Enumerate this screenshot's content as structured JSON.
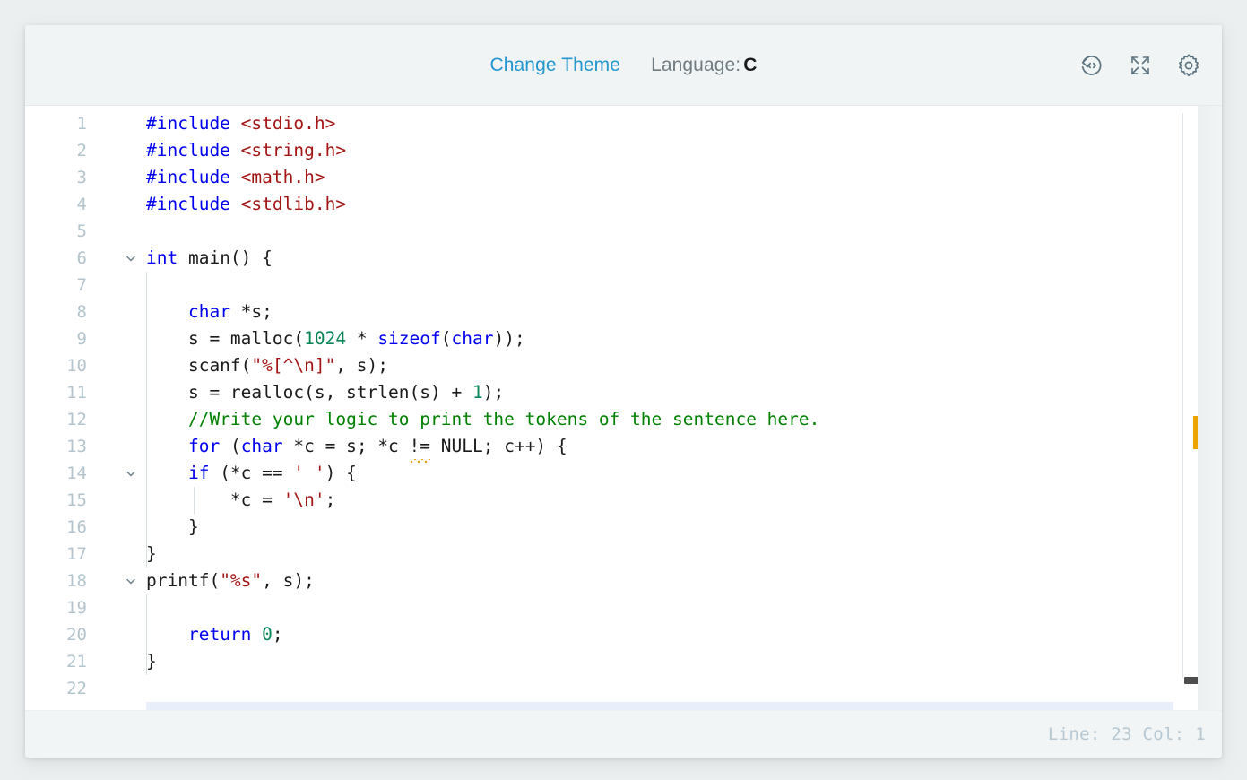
{
  "header": {
    "change_theme_label": "Change Theme",
    "language_prefix": "Language:",
    "language_value": "C",
    "icons": {
      "restore": "restore-code-icon",
      "fullscreen": "fullscreen-icon",
      "settings": "settings-gear-icon"
    }
  },
  "editor": {
    "language": "C",
    "total_lines": 22,
    "visible_first_line": 1,
    "visible_last_line": 22,
    "lines": [
      {
        "n": "1",
        "fold": false,
        "indent_guides": 0,
        "tokens": [
          {
            "t": "#include ",
            "c": "pre"
          },
          {
            "t": "<stdio.h>",
            "c": "hdr"
          }
        ]
      },
      {
        "n": "2",
        "fold": false,
        "indent_guides": 0,
        "tokens": [
          {
            "t": "#include ",
            "c": "pre"
          },
          {
            "t": "<string.h>",
            "c": "hdr"
          }
        ]
      },
      {
        "n": "3",
        "fold": false,
        "indent_guides": 0,
        "tokens": [
          {
            "t": "#include ",
            "c": "pre"
          },
          {
            "t": "<math.h>",
            "c": "hdr"
          }
        ]
      },
      {
        "n": "4",
        "fold": false,
        "indent_guides": 0,
        "tokens": [
          {
            "t": "#include ",
            "c": "pre"
          },
          {
            "t": "<stdlib.h>",
            "c": "hdr"
          }
        ]
      },
      {
        "n": "5",
        "fold": false,
        "indent_guides": 0,
        "tokens": []
      },
      {
        "n": "6",
        "fold": true,
        "indent_guides": 0,
        "tokens": [
          {
            "t": "int",
            "c": "kw"
          },
          {
            "t": " main() {",
            "c": "plain"
          }
        ]
      },
      {
        "n": "7",
        "fold": false,
        "indent_guides": 1,
        "tokens": []
      },
      {
        "n": "8",
        "fold": false,
        "indent_guides": 1,
        "tokens": [
          {
            "t": "    ",
            "c": "plain"
          },
          {
            "t": "char",
            "c": "kw"
          },
          {
            "t": " *s;",
            "c": "plain"
          }
        ]
      },
      {
        "n": "9",
        "fold": false,
        "indent_guides": 1,
        "tokens": [
          {
            "t": "    s = malloc(",
            "c": "plain"
          },
          {
            "t": "1024",
            "c": "num"
          },
          {
            "t": " * ",
            "c": "plain"
          },
          {
            "t": "sizeof",
            "c": "kw"
          },
          {
            "t": "(",
            "c": "plain"
          },
          {
            "t": "char",
            "c": "kw"
          },
          {
            "t": "));",
            "c": "plain"
          }
        ]
      },
      {
        "n": "10",
        "fold": false,
        "indent_guides": 1,
        "tokens": [
          {
            "t": "    scanf(",
            "c": "plain"
          },
          {
            "t": "\"%[^\\n]\"",
            "c": "str"
          },
          {
            "t": ", s);",
            "c": "plain"
          }
        ]
      },
      {
        "n": "11",
        "fold": false,
        "indent_guides": 1,
        "tokens": [
          {
            "t": "    s = realloc(s, strlen(s) + ",
            "c": "plain"
          },
          {
            "t": "1",
            "c": "num"
          },
          {
            "t": ");",
            "c": "plain"
          }
        ]
      },
      {
        "n": "12",
        "fold": false,
        "indent_guides": 1,
        "tokens": [
          {
            "t": "    ",
            "c": "plain"
          },
          {
            "t": "//Write your logic to print the tokens of the sentence here.",
            "c": "com"
          }
        ]
      },
      {
        "n": "13",
        "fold": false,
        "indent_guides": 1,
        "tokens": [
          {
            "t": "    ",
            "c": "plain"
          },
          {
            "t": "for",
            "c": "kw"
          },
          {
            "t": " (",
            "c": "plain"
          },
          {
            "t": "char",
            "c": "kw"
          },
          {
            "t": " *c = s; *c ",
            "c": "plain"
          },
          {
            "t": "!=",
            "c": "plain",
            "squiggle": true
          },
          {
            "t": " NULL; c++) {",
            "c": "plain"
          }
        ]
      },
      {
        "n": "14",
        "fold": true,
        "indent_guides": 1,
        "tokens": [
          {
            "t": "    ",
            "c": "plain"
          },
          {
            "t": "if",
            "c": "kw"
          },
          {
            "t": " (*c == ",
            "c": "plain"
          },
          {
            "t": "' '",
            "c": "str"
          },
          {
            "t": ") {",
            "c": "plain"
          }
        ]
      },
      {
        "n": "15",
        "fold": false,
        "indent_guides": 2,
        "tokens": [
          {
            "t": "        *c = ",
            "c": "plain"
          },
          {
            "t": "'\\n'",
            "c": "str"
          },
          {
            "t": ";",
            "c": "plain"
          }
        ]
      },
      {
        "n": "16",
        "fold": false,
        "indent_guides": 1,
        "tokens": [
          {
            "t": "    }",
            "c": "plain"
          }
        ]
      },
      {
        "n": "17",
        "fold": false,
        "indent_guides": 1,
        "tokens": [
          {
            "t": "}",
            "c": "plain"
          }
        ]
      },
      {
        "n": "18",
        "fold": true,
        "indent_guides": 0,
        "tokens": [
          {
            "t": "printf(",
            "c": "plain"
          },
          {
            "t": "\"%s\"",
            "c": "str"
          },
          {
            "t": ", s);",
            "c": "plain"
          }
        ]
      },
      {
        "n": "19",
        "fold": false,
        "indent_guides": 1,
        "tokens": []
      },
      {
        "n": "20",
        "fold": false,
        "indent_guides": 1,
        "tokens": [
          {
            "t": "    ",
            "c": "plain"
          },
          {
            "t": "return",
            "c": "kw"
          },
          {
            "t": " ",
            "c": "plain"
          },
          {
            "t": "0",
            "c": "num"
          },
          {
            "t": ";",
            "c": "plain"
          }
        ]
      },
      {
        "n": "21",
        "fold": false,
        "indent_guides": 1,
        "tokens": [
          {
            "t": "}",
            "c": "plain"
          }
        ]
      },
      {
        "n": "22",
        "fold": false,
        "indent_guides": 0,
        "tokens": []
      }
    ]
  },
  "gutter": {
    "warning_marker": true,
    "warning_color": "#eda400",
    "scrollbar_thumb_color": "#4d4d4d"
  },
  "status": {
    "text": "Line: 23 Col: 1",
    "line": "23",
    "col": "1"
  },
  "colors": {
    "page_background": "#eceff0",
    "card_background": "#ffffff",
    "header_background": "#f1f4f5",
    "status_background": "#f2f5f6",
    "link": "#2196cf",
    "keyword": "#0000f0",
    "string": "#a31515",
    "number": "#098658",
    "comment": "#008000",
    "line_number": "#b3c4cd",
    "current_line_highlight": "#e8effb"
  }
}
